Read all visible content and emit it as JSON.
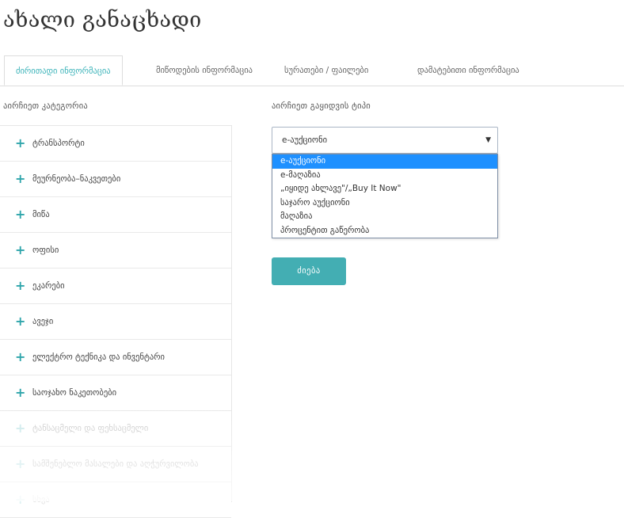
{
  "page": {
    "title": "ახალი განაცხადი"
  },
  "tabs": [
    {
      "label": "ძირითადი ინფორმაცია",
      "active": true
    },
    {
      "label": "მიწოდების ინფორმაცია",
      "active": false
    },
    {
      "label": "სურათები / ფაილები",
      "active": false
    },
    {
      "label": "დამატებითი ინფორმაცია",
      "active": false
    }
  ],
  "category": {
    "label": "აირჩიეთ კატეგორია",
    "items": [
      {
        "label": "ტრანსპორტი"
      },
      {
        "label": "მეურნეობა–ნაკვეთები"
      },
      {
        "label": "მიწა"
      },
      {
        "label": "ოფისი"
      },
      {
        "label": "ეკარები"
      },
      {
        "label": "ავეჯი"
      },
      {
        "label": "ელექტრო ტექნიკა და ინვენტარი"
      },
      {
        "label": "საოჯახო ნაკეთობები"
      },
      {
        "label": "ტანსაცმელი და ფეხსაცმელი"
      },
      {
        "label": "სამშენებლო მასალები და აღჭურვილობა"
      },
      {
        "label": "სხვა"
      }
    ]
  },
  "auction_type": {
    "label": "აირჩიეთ გაყიდვის ტიპი",
    "selected": "e-აუქციონი",
    "options": [
      {
        "label": "e-აუქციონი",
        "selected": true
      },
      {
        "label": "e-მაღაზია",
        "selected": false
      },
      {
        "label": "„იყიდე ახლავე\"/„Buy It Now\"",
        "selected": false
      },
      {
        "label": "საჯარო აუქციონი",
        "selected": false
      },
      {
        "label": "მაღაზია",
        "selected": false
      },
      {
        "label": "პროცენტით გაწერობა",
        "selected": false
      }
    ]
  },
  "search_button": {
    "label": "ძიება"
  },
  "colors": {
    "accent": "#43aeb3",
    "tab_active": "#3bb3b9",
    "highlight": "#1e90ff"
  }
}
